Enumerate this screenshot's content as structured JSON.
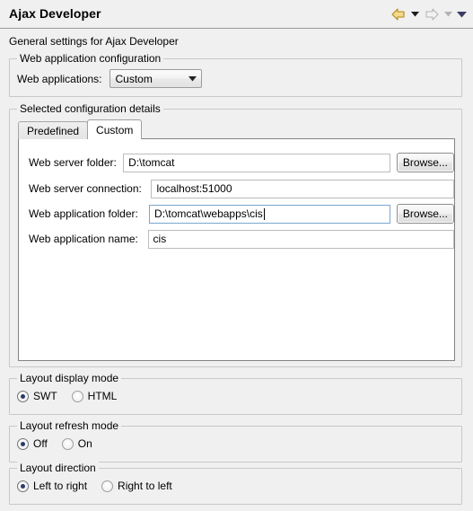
{
  "header": {
    "title": "Ajax Developer",
    "nav": {
      "back_icon": "back-arrow-icon",
      "back_menu_icon": "chevron-down-icon",
      "forward_icon": "forward-arrow-icon",
      "forward_menu_icon": "chevron-down-icon",
      "menu_icon": "chevron-down-icon"
    }
  },
  "description": "General settings for Ajax Developer",
  "webapp_config": {
    "group_label": "Web application configuration",
    "field_label": "Web applications:",
    "selected_value": "Custom",
    "options": [
      "Custom"
    ]
  },
  "config_details": {
    "group_label": "Selected configuration details",
    "tabs": [
      {
        "label": "Predefined",
        "active": false
      },
      {
        "label": "Custom",
        "active": true
      }
    ],
    "fields": [
      {
        "label": "Web server folder:",
        "value": "D:\\tomcat",
        "placeholder": "",
        "focused": false,
        "has_browse": true,
        "browse_label": "Browse...",
        "label_width": 102,
        "input_width": 309
      },
      {
        "label": "Web server connection:",
        "value": "localhost:51000",
        "placeholder": "",
        "focused": false,
        "has_browse": false,
        "browse_label": "",
        "label_width": 132,
        "input_width": 344
      },
      {
        "label": "Web application folder:",
        "value": "D:\\tomcat\\webapps\\cis",
        "placeholder": "",
        "focused": true,
        "has_browse": true,
        "browse_label": "Browse...",
        "label_width": 132,
        "input_width": 279
      },
      {
        "label": "Web application name:",
        "value": "cis",
        "placeholder": "",
        "focused": false,
        "has_browse": false,
        "browse_label": "",
        "label_width": 128,
        "input_width": 348
      }
    ]
  },
  "display_mode": {
    "group_label": "Layout display mode",
    "options": [
      {
        "label": "SWT",
        "checked": true
      },
      {
        "label": "HTML",
        "checked": false
      }
    ]
  },
  "refresh_mode": {
    "group_label": "Layout refresh mode",
    "options": [
      {
        "label": "Off",
        "checked": true
      },
      {
        "label": "On",
        "checked": false
      }
    ]
  },
  "direction": {
    "group_label": "Layout direction",
    "options": [
      {
        "label": "Left to right",
        "checked": true
      },
      {
        "label": "Right to left",
        "checked": false
      }
    ]
  },
  "colors": {
    "background": "#f0f0f0",
    "panel": "#ffffff",
    "border": "#c8c8c8",
    "focus_border": "#7aa7cd",
    "radio_dot": "#2b3b6b",
    "back_arrow": "#e8b33c",
    "forward_arrow": "#c9c9c9"
  }
}
